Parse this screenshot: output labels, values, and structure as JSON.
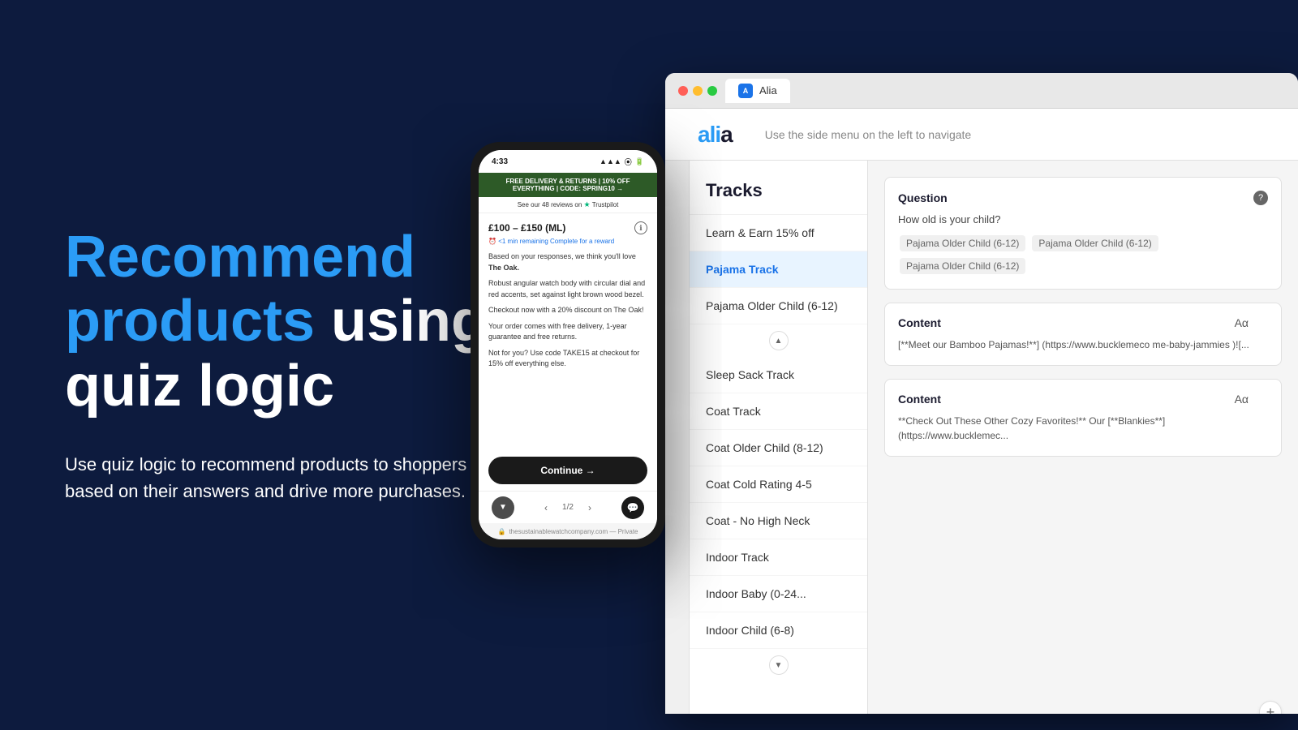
{
  "page": {
    "background_color": "#0d1b3e"
  },
  "left": {
    "headline_line1_blue": "Recommend",
    "headline_line2": "products",
    "headline_line2_white": " using",
    "headline_line3": "quiz logic",
    "subtext": "Use quiz logic to recommend products to shoppers based on their answers and drive more purchases."
  },
  "browser": {
    "tab_label": "Alia",
    "app_logo": "alia",
    "app_header_hint": "Use the side menu on the left to navigate"
  },
  "tracks": {
    "title": "Tracks",
    "items": [
      {
        "label": "Learn & Earn 15% off",
        "active": false
      },
      {
        "label": "Pajama Track",
        "active": true
      },
      {
        "label": "Pajama Older Child (6-12)",
        "active": false
      },
      {
        "label": "Sleep Sack Track",
        "active": false
      },
      {
        "label": "Coat Track",
        "active": false
      },
      {
        "label": "Coat Older Child (8-12)",
        "active": false
      },
      {
        "label": "Coat Cold Rating 4-5",
        "active": false
      },
      {
        "label": "Coat - No High Neck",
        "active": false
      },
      {
        "label": "Indoor Track",
        "active": false
      },
      {
        "label": "Indoor Baby (0-24...",
        "active": false
      },
      {
        "label": "Indoor Child (6-8)",
        "active": false
      }
    ]
  },
  "cards": {
    "question_card": {
      "title": "Question",
      "question_text": "How old is your child?",
      "tags": [
        "Pajama Older Child (6-12)",
        "Pajama Older Child (6-12)",
        "Pajama Older Child (6-12)"
      ]
    },
    "content_card1": {
      "title": "Content",
      "text": "[**Meet our Bamboo Pajamas!**] (https://www.bucklemeco me-baby-jammies )![..."
    },
    "content_card2": {
      "title": "Content",
      "text": "**Check Out These Other Cozy Favorites!** Our [**Blankies**] (https://www.bucklemec..."
    }
  },
  "phone": {
    "time": "4:33",
    "banner": "FREE DELIVERY & RETURNS | 10% OFF EVERYTHING | CODE: SPRING10 →",
    "trustpilot": "See our 48 reviews on ★ Trustpilot",
    "price_range": "£100 – £150 (ML)",
    "timer": "⏰ <1 min remaining  Complete for a reward",
    "recommendation_text": "Based on your responses, we think you'll love The Oak.",
    "description1": "Robust angular watch body with circular dial and red accents, set against light brown wood bezel.",
    "description2": "Checkout now with a 20% discount on The Oak!",
    "description3": "Your order comes with free delivery, 1-year guarantee and free returns.",
    "description4": "Not for you? Use code TAKE15 at checkout for 15% off everything else.",
    "continue_btn": "Continue →",
    "page_indicator": "1/2",
    "bottom_url": "thesustainablewatchcompany.com — Private"
  }
}
